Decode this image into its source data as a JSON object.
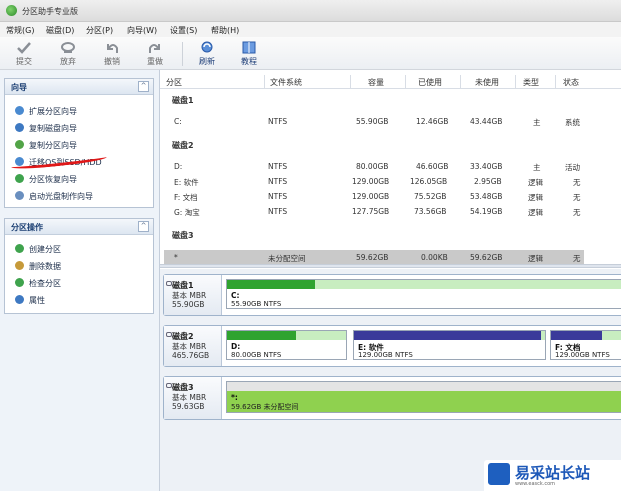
{
  "window": {
    "title": "分区助手专业版"
  },
  "menu": [
    {
      "label": "常规(G)"
    },
    {
      "label": "磁盘(D)"
    },
    {
      "label": "分区(P)"
    },
    {
      "label": "向导(W)"
    },
    {
      "label": "设置(S)"
    },
    {
      "label": "帮助(H)"
    }
  ],
  "toolbar": {
    "commit": "提交",
    "discard": "放弃",
    "undo": "撤销",
    "redo": "重做",
    "refresh": "刷新",
    "tutorial": "教程"
  },
  "wizard_panel": {
    "title": "向导",
    "items": [
      {
        "label": "扩展分区向导"
      },
      {
        "label": "复制磁盘向导"
      },
      {
        "label": "复制分区向导"
      },
      {
        "label": "迁移OS到SSD/HDD"
      },
      {
        "label": "分区恢复向导"
      },
      {
        "label": "启动光盘制作向导"
      }
    ]
  },
  "ops_panel": {
    "title": "分区操作",
    "items": [
      {
        "label": "创建分区"
      },
      {
        "label": "删除数据"
      },
      {
        "label": "检查分区"
      },
      {
        "label": "属性"
      }
    ]
  },
  "columns": [
    "分区",
    "文件系统",
    "容量",
    "已使用",
    "未使用",
    "类型",
    "状态"
  ],
  "disks": [
    {
      "label": "磁盘1",
      "rows": [
        {
          "name": "C:",
          "fs": "NTFS",
          "cap": "55.90GB",
          "used": "12.46GB",
          "free": "43.44GB",
          "type": "主",
          "status": "系统"
        }
      ]
    },
    {
      "label": "磁盘2",
      "rows": [
        {
          "name": "D:",
          "fs": "NTFS",
          "cap": "80.00GB",
          "used": "46.60GB",
          "free": "33.40GB",
          "type": "主",
          "status": "活动"
        },
        {
          "name": "E: 软件",
          "fs": "NTFS",
          "cap": "129.00GB",
          "used": "126.05GB",
          "free": "2.95GB",
          "type": "逻辑",
          "status": "无"
        },
        {
          "name": "F: 文档",
          "fs": "NTFS",
          "cap": "129.00GB",
          "used": "75.52GB",
          "free": "53.48GB",
          "type": "逻辑",
          "status": "无"
        },
        {
          "name": "G: 淘宝",
          "fs": "NTFS",
          "cap": "127.75GB",
          "used": "73.56GB",
          "free": "54.19GB",
          "type": "逻辑",
          "status": "无"
        }
      ]
    },
    {
      "label": "磁盘3",
      "rows": [
        {
          "name": "*",
          "fs": "未分配空间",
          "cap": "59.62GB",
          "used": "0.00KB",
          "free": "59.62GB",
          "type": "逻辑",
          "status": "无"
        }
      ]
    }
  ],
  "map": [
    {
      "title": "磁盘1",
      "kind": "基本 MBR",
      "size": "55.90GB",
      "parts": [
        {
          "name": "C:",
          "sub": "55.90GB NTFS",
          "used": 0.22,
          "color": "#2fa32f"
        }
      ]
    },
    {
      "title": "磁盘2",
      "kind": "基本 MBR",
      "size": "465.76GB",
      "parts": [
        {
          "name": "D:",
          "sub": "80.00GB NTFS",
          "used": 0.58,
          "color": "#2fa32f"
        },
        {
          "name": "E: 软件",
          "sub": "129.00GB NTFS",
          "used": 0.98,
          "color": "#3a3a9a"
        },
        {
          "name": "F: 文档",
          "sub": "129.00GB NTFS",
          "used": 0.58,
          "color": "#3a3a9a"
        }
      ]
    },
    {
      "title": "磁盘3",
      "kind": "基本 MBR",
      "size": "59.63GB",
      "parts": [
        {
          "name": "*:",
          "sub": "59.62GB 未分配空间",
          "used": 0,
          "color": "#8fd14f"
        }
      ]
    }
  ],
  "watermark": {
    "brand": "易采站长站",
    "sub": "www.easck.com"
  }
}
